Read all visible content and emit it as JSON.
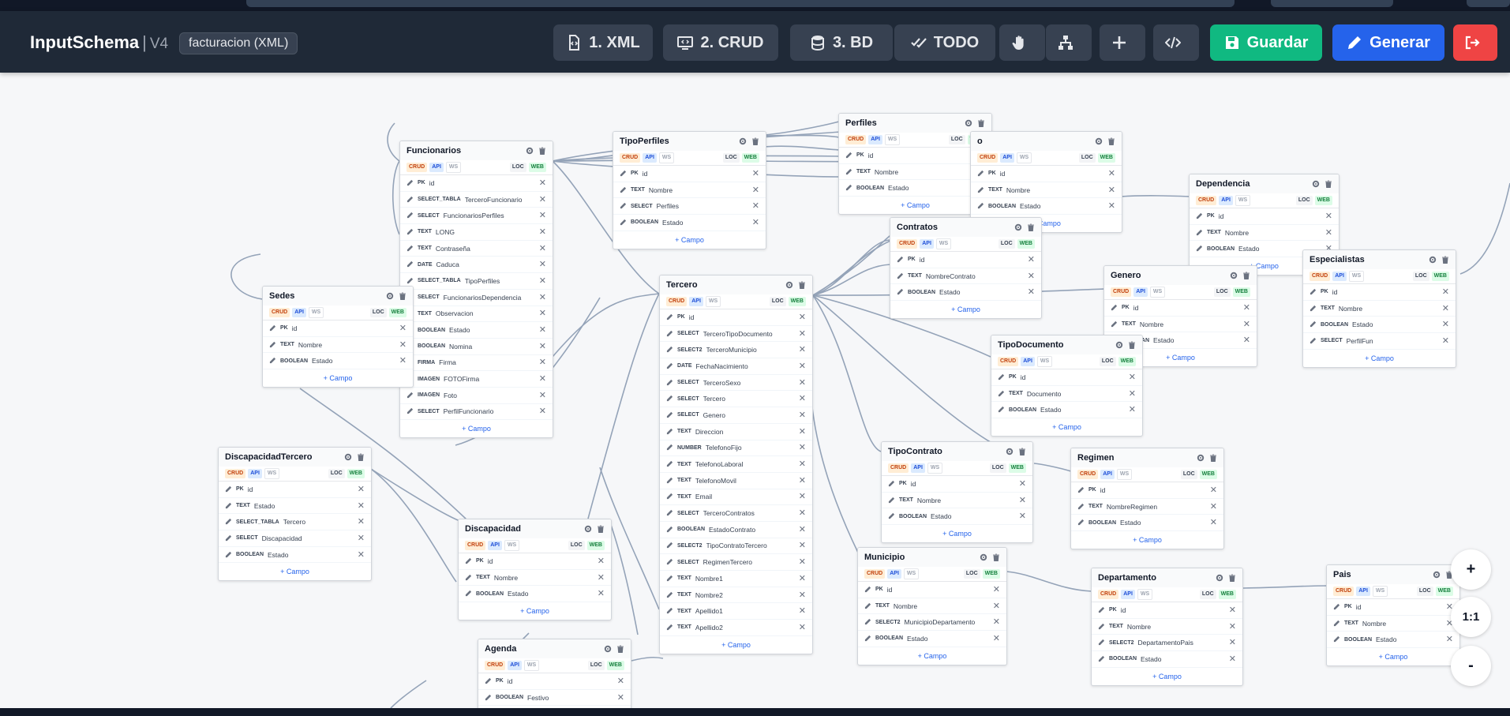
{
  "header": {
    "app_name": "InputSchema",
    "separator": "|",
    "version": "V4",
    "project": "facturacion (XML)",
    "buttons": [
      {
        "label": "1. XML"
      },
      {
        "label": "2. CRUD"
      },
      {
        "label": "3. BD"
      },
      {
        "label": "TODO"
      },
      {
        "label": ""
      },
      {
        "label": ""
      },
      {
        "label": ""
      },
      {
        "label": ""
      },
      {
        "label": "Guardar"
      },
      {
        "label": "Generar"
      },
      {
        "label": ""
      }
    ]
  },
  "badges": {
    "crud": "CRUD",
    "api": "API",
    "ws": "WS",
    "loc": "LOC",
    "web": "WEB"
  },
  "add_field": "+ Campo",
  "remove_icon": "✕",
  "zoom": {
    "in": "+",
    "reset": "1:1",
    "out": "-"
  },
  "colors": {
    "header_bg": "#1f2937",
    "guardar": "#10b981",
    "generar": "#2563eb",
    "salir": "#ef4444",
    "crud": "#c2410c",
    "api": "#1d4ed8",
    "web": "#15803d"
  },
  "tables": [
    {
      "name": "Funcionarios",
      "fields": [
        [
          "PK",
          "id"
        ],
        [
          "SELECT_TABLA",
          "TerceroFuncionario"
        ],
        [
          "SELECT",
          "FuncionariosPerfiles"
        ],
        [
          "TEXT",
          "LONG"
        ],
        [
          "TEXT",
          "Contraseña"
        ],
        [
          "DATE",
          "Caduca"
        ],
        [
          "SELECT_TABLA",
          "TipoPerfiles"
        ],
        [
          "SELECT",
          "FuncionariosDependencia"
        ],
        [
          "TEXT",
          "Observacion"
        ],
        [
          "BOOLEAN",
          "Estado"
        ],
        [
          "BOOLEAN",
          "Nomina"
        ],
        [
          "FIRMA",
          "Firma"
        ],
        [
          "IMAGEN",
          "FOTOFirma"
        ],
        [
          "IMAGEN",
          "Foto"
        ],
        [
          "SELECT",
          "PerfilFuncionario"
        ]
      ]
    },
    {
      "name": "TipoPerfiles",
      "fields": [
        [
          "PK",
          "id"
        ],
        [
          "TEXT",
          "Nombre"
        ],
        [
          "SELECT",
          "Perfiles"
        ],
        [
          "BOOLEAN",
          "Estado"
        ]
      ]
    },
    {
      "name": "Perfiles",
      "fields": [
        [
          "PK",
          "id"
        ],
        [
          "TEXT",
          "Nombre"
        ],
        [
          "BOOLEAN",
          "Estado"
        ]
      ]
    },
    {
      "name": "o",
      "fields": [
        [
          "PK",
          "id"
        ],
        [
          "TEXT",
          "Nombre"
        ],
        [
          "BOOLEAN",
          "Estado"
        ]
      ]
    },
    {
      "name": "Dependencia",
      "fields": [
        [
          "PK",
          "id"
        ],
        [
          "TEXT",
          "Nombre"
        ],
        [
          "BOOLEAN",
          "Estado"
        ]
      ]
    },
    {
      "name": "Sedes",
      "fields": [
        [
          "PK",
          "id"
        ],
        [
          "TEXT",
          "Nombre"
        ],
        [
          "BOOLEAN",
          "Estado"
        ]
      ]
    },
    {
      "name": "Tercero",
      "fields": [
        [
          "PK",
          "id"
        ],
        [
          "SELECT",
          "TerceroTipoDocumento"
        ],
        [
          "SELECT2",
          "TerceroMunicipio"
        ],
        [
          "DATE",
          "FechaNacimiento"
        ],
        [
          "SELECT",
          "TerceroSexo"
        ],
        [
          "SELECT",
          "Tercero"
        ],
        [
          "SELECT",
          "Genero"
        ],
        [
          "TEXT",
          "Direccion"
        ],
        [
          "NUMBER",
          "TelefonoFijo"
        ],
        [
          "TEXT",
          "TelefonoLaboral"
        ],
        [
          "TEXT",
          "TelefonoMovil"
        ],
        [
          "TEXT",
          "Email"
        ],
        [
          "SELECT",
          "TerceroContratos"
        ],
        [
          "BOOLEAN",
          "EstadoContrato"
        ],
        [
          "SELECT2",
          "TipoContratoTercero"
        ],
        [
          "SELECT",
          "RegimenTercero"
        ],
        [
          "TEXT",
          "Nombre1"
        ],
        [
          "TEXT",
          "Nombre2"
        ],
        [
          "TEXT",
          "Apellido1"
        ],
        [
          "TEXT",
          "Apellido2"
        ]
      ]
    },
    {
      "name": "Contratos",
      "fields": [
        [
          "PK",
          "id"
        ],
        [
          "TEXT",
          "NombreContrato"
        ],
        [
          "BOOLEAN",
          "Estado"
        ]
      ]
    },
    {
      "name": "Genero",
      "fields": [
        [
          "PK",
          "id"
        ],
        [
          "TEXT",
          "Nombre"
        ],
        [
          "BOOLEAN",
          "Estado"
        ]
      ]
    },
    {
      "name": "Especialistas",
      "fields": [
        [
          "PK",
          "id"
        ],
        [
          "TEXT",
          "Nombre"
        ],
        [
          "BOOLEAN",
          "Estado"
        ],
        [
          "SELECT",
          "PerfilFun"
        ]
      ]
    },
    {
      "name": "TipoDocumento",
      "fields": [
        [
          "PK",
          "id"
        ],
        [
          "TEXT",
          "Documento"
        ],
        [
          "BOOLEAN",
          "Estado"
        ]
      ]
    },
    {
      "name": "DiscapacidadTercero",
      "fields": [
        [
          "PK",
          "id"
        ],
        [
          "TEXT",
          "Estado"
        ],
        [
          "SELECT_TABLA",
          "Tercero"
        ],
        [
          "SELECT",
          "Discapacidad"
        ],
        [
          "BOOLEAN",
          "Estado"
        ]
      ]
    },
    {
      "name": "TipoContrato",
      "fields": [
        [
          "PK",
          "id"
        ],
        [
          "TEXT",
          "Nombre"
        ],
        [
          "BOOLEAN",
          "Estado"
        ]
      ]
    },
    {
      "name": "Regimen",
      "fields": [
        [
          "PK",
          "id"
        ],
        [
          "TEXT",
          "NombreRegimen"
        ],
        [
          "BOOLEAN",
          "Estado"
        ]
      ]
    },
    {
      "name": "Discapacidad",
      "fields": [
        [
          "PK",
          "id"
        ],
        [
          "TEXT",
          "Nombre"
        ],
        [
          "BOOLEAN",
          "Estado"
        ]
      ]
    },
    {
      "name": "Municipio",
      "fields": [
        [
          "PK",
          "id"
        ],
        [
          "TEXT",
          "Nombre"
        ],
        [
          "SELECT2",
          "MunicipioDepartamento"
        ],
        [
          "BOOLEAN",
          "Estado"
        ]
      ]
    },
    {
      "name": "Departamento",
      "fields": [
        [
          "PK",
          "id"
        ],
        [
          "TEXT",
          "Nombre"
        ],
        [
          "SELECT2",
          "DepartamentoPais"
        ],
        [
          "BOOLEAN",
          "Estado"
        ]
      ]
    },
    {
      "name": "Pais",
      "fields": [
        [
          "PK",
          "id"
        ],
        [
          "TEXT",
          "Nombre"
        ],
        [
          "BOOLEAN",
          "Estado"
        ]
      ]
    },
    {
      "name": "Agenda",
      "fields": [
        [
          "PK",
          "id"
        ],
        [
          "BOOLEAN",
          "Festivo"
        ]
      ]
    }
  ]
}
